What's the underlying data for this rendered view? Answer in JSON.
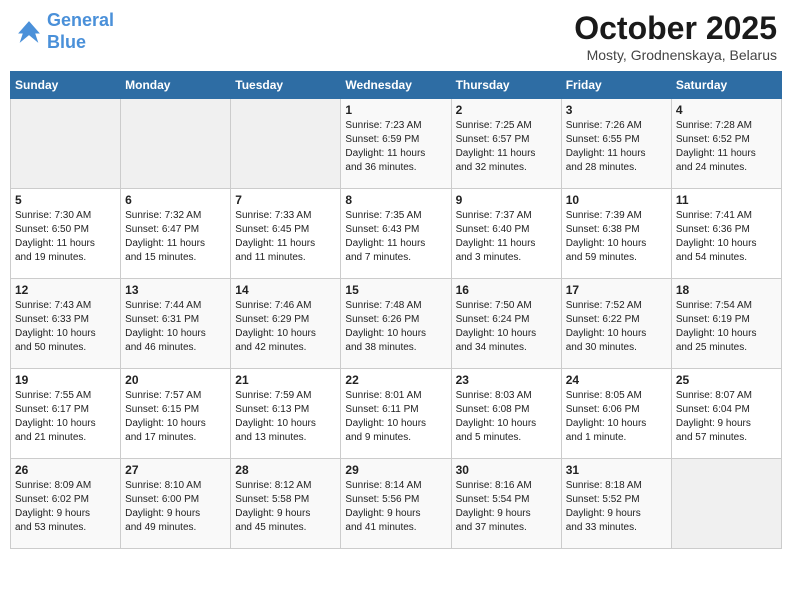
{
  "header": {
    "logo_line1": "General",
    "logo_line2": "Blue",
    "month": "October 2025",
    "location": "Mosty, Grodnenskaya, Belarus"
  },
  "days_of_week": [
    "Sunday",
    "Monday",
    "Tuesday",
    "Wednesday",
    "Thursday",
    "Friday",
    "Saturday"
  ],
  "weeks": [
    [
      {
        "day": "",
        "info": ""
      },
      {
        "day": "",
        "info": ""
      },
      {
        "day": "",
        "info": ""
      },
      {
        "day": "1",
        "info": "Sunrise: 7:23 AM\nSunset: 6:59 PM\nDaylight: 11 hours\nand 36 minutes."
      },
      {
        "day": "2",
        "info": "Sunrise: 7:25 AM\nSunset: 6:57 PM\nDaylight: 11 hours\nand 32 minutes."
      },
      {
        "day": "3",
        "info": "Sunrise: 7:26 AM\nSunset: 6:55 PM\nDaylight: 11 hours\nand 28 minutes."
      },
      {
        "day": "4",
        "info": "Sunrise: 7:28 AM\nSunset: 6:52 PM\nDaylight: 11 hours\nand 24 minutes."
      }
    ],
    [
      {
        "day": "5",
        "info": "Sunrise: 7:30 AM\nSunset: 6:50 PM\nDaylight: 11 hours\nand 19 minutes."
      },
      {
        "day": "6",
        "info": "Sunrise: 7:32 AM\nSunset: 6:47 PM\nDaylight: 11 hours\nand 15 minutes."
      },
      {
        "day": "7",
        "info": "Sunrise: 7:33 AM\nSunset: 6:45 PM\nDaylight: 11 hours\nand 11 minutes."
      },
      {
        "day": "8",
        "info": "Sunrise: 7:35 AM\nSunset: 6:43 PM\nDaylight: 11 hours\nand 7 minutes."
      },
      {
        "day": "9",
        "info": "Sunrise: 7:37 AM\nSunset: 6:40 PM\nDaylight: 11 hours\nand 3 minutes."
      },
      {
        "day": "10",
        "info": "Sunrise: 7:39 AM\nSunset: 6:38 PM\nDaylight: 10 hours\nand 59 minutes."
      },
      {
        "day": "11",
        "info": "Sunrise: 7:41 AM\nSunset: 6:36 PM\nDaylight: 10 hours\nand 54 minutes."
      }
    ],
    [
      {
        "day": "12",
        "info": "Sunrise: 7:43 AM\nSunset: 6:33 PM\nDaylight: 10 hours\nand 50 minutes."
      },
      {
        "day": "13",
        "info": "Sunrise: 7:44 AM\nSunset: 6:31 PM\nDaylight: 10 hours\nand 46 minutes."
      },
      {
        "day": "14",
        "info": "Sunrise: 7:46 AM\nSunset: 6:29 PM\nDaylight: 10 hours\nand 42 minutes."
      },
      {
        "day": "15",
        "info": "Sunrise: 7:48 AM\nSunset: 6:26 PM\nDaylight: 10 hours\nand 38 minutes."
      },
      {
        "day": "16",
        "info": "Sunrise: 7:50 AM\nSunset: 6:24 PM\nDaylight: 10 hours\nand 34 minutes."
      },
      {
        "day": "17",
        "info": "Sunrise: 7:52 AM\nSunset: 6:22 PM\nDaylight: 10 hours\nand 30 minutes."
      },
      {
        "day": "18",
        "info": "Sunrise: 7:54 AM\nSunset: 6:19 PM\nDaylight: 10 hours\nand 25 minutes."
      }
    ],
    [
      {
        "day": "19",
        "info": "Sunrise: 7:55 AM\nSunset: 6:17 PM\nDaylight: 10 hours\nand 21 minutes."
      },
      {
        "day": "20",
        "info": "Sunrise: 7:57 AM\nSunset: 6:15 PM\nDaylight: 10 hours\nand 17 minutes."
      },
      {
        "day": "21",
        "info": "Sunrise: 7:59 AM\nSunset: 6:13 PM\nDaylight: 10 hours\nand 13 minutes."
      },
      {
        "day": "22",
        "info": "Sunrise: 8:01 AM\nSunset: 6:11 PM\nDaylight: 10 hours\nand 9 minutes."
      },
      {
        "day": "23",
        "info": "Sunrise: 8:03 AM\nSunset: 6:08 PM\nDaylight: 10 hours\nand 5 minutes."
      },
      {
        "day": "24",
        "info": "Sunrise: 8:05 AM\nSunset: 6:06 PM\nDaylight: 10 hours\nand 1 minute."
      },
      {
        "day": "25",
        "info": "Sunrise: 8:07 AM\nSunset: 6:04 PM\nDaylight: 9 hours\nand 57 minutes."
      }
    ],
    [
      {
        "day": "26",
        "info": "Sunrise: 8:09 AM\nSunset: 6:02 PM\nDaylight: 9 hours\nand 53 minutes."
      },
      {
        "day": "27",
        "info": "Sunrise: 8:10 AM\nSunset: 6:00 PM\nDaylight: 9 hours\nand 49 minutes."
      },
      {
        "day": "28",
        "info": "Sunrise: 8:12 AM\nSunset: 5:58 PM\nDaylight: 9 hours\nand 45 minutes."
      },
      {
        "day": "29",
        "info": "Sunrise: 8:14 AM\nSunset: 5:56 PM\nDaylight: 9 hours\nand 41 minutes."
      },
      {
        "day": "30",
        "info": "Sunrise: 8:16 AM\nSunset: 5:54 PM\nDaylight: 9 hours\nand 37 minutes."
      },
      {
        "day": "31",
        "info": "Sunrise: 8:18 AM\nSunset: 5:52 PM\nDaylight: 9 hours\nand 33 minutes."
      },
      {
        "day": "",
        "info": ""
      }
    ]
  ]
}
